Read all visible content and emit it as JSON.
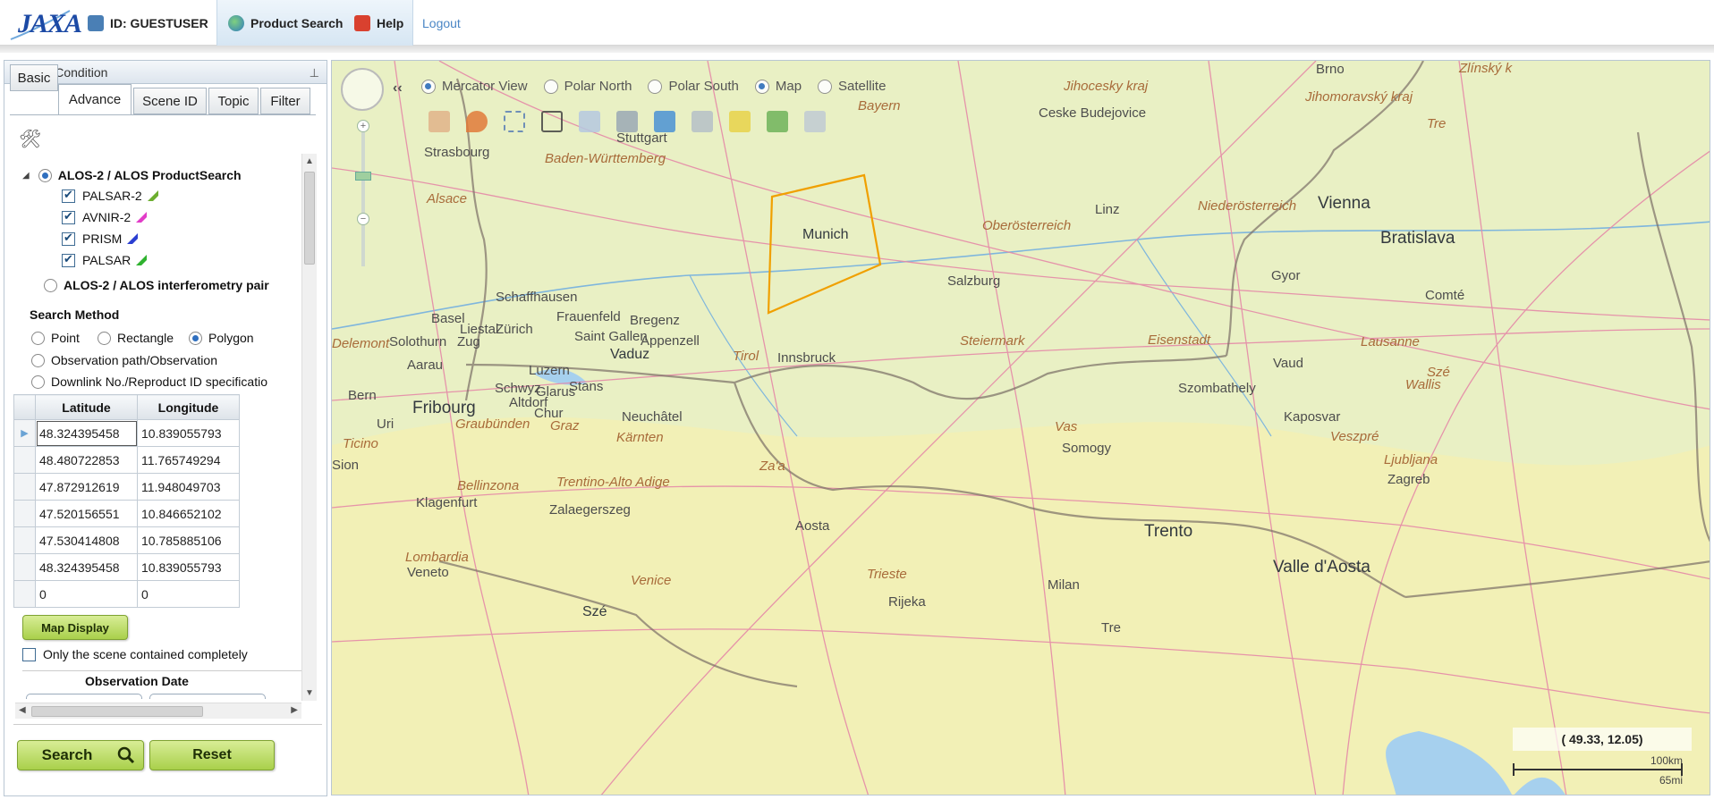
{
  "header": {
    "logo": "JAXA",
    "user_id": "ID: GUESTUSER",
    "product_search": "Product Search",
    "help": "Help",
    "logout": "Logout"
  },
  "panel": {
    "title": "Search Condition",
    "tabs": [
      "Basic",
      "Advance",
      "Scene ID",
      "Topic",
      "Filter"
    ],
    "tree": {
      "group1": "ALOS-2 / ALOS ProductSearch",
      "sensors": [
        "PALSAR-2",
        "AVNIR-2",
        "PRISM",
        "PALSAR"
      ],
      "group2": "ALOS-2 / ALOS interferometry pair"
    },
    "search_method": {
      "label": "Search Method",
      "options": [
        "Point",
        "Rectangle",
        "Polygon"
      ],
      "selected": "Polygon",
      "observation_path": "Observation path/Observation",
      "downlink": "Downlink No./Reproduct ID specificatio"
    },
    "coords_table": {
      "headers": [
        "Latitude",
        "Longitude"
      ],
      "rows": [
        [
          "48.324395458",
          "10.839055793"
        ],
        [
          "48.480722853",
          "11.765749294"
        ],
        [
          "47.872912619",
          "11.948049703"
        ],
        [
          "47.520156551",
          "10.846652102"
        ],
        [
          "47.530414808",
          "10.785885106"
        ],
        [
          "48.324395458",
          "10.839055793"
        ],
        [
          "0",
          "0"
        ]
      ]
    },
    "map_display": "Map Display",
    "only_scene": "Only the scene contained completely",
    "observation_date": "Observation Date",
    "search": "Search",
    "reset": "Reset"
  },
  "map": {
    "views": [
      "Mercator View",
      "Polar North",
      "Polar South"
    ],
    "layers": [
      "Map",
      "Satellite"
    ],
    "coord": "( 49.33, 12.05)",
    "scale_km": "100km",
    "scale_mi": "65mi",
    "places": [
      "Stuttgart",
      "Strasbourg",
      "Baden-Württemberg",
      "Bayern",
      "Jihocesky kraj",
      "Ceske Budejovice",
      "Jihomoravský kraj",
      "Brno",
      "Zlínský k",
      "Alsace",
      "Munich",
      "Linz",
      "Oberösterreich",
      "Niederösterreich",
      "Vienna",
      "Bratislava",
      "Schaffhausen",
      "Basel",
      "Liestal",
      "Zürich",
      "Frauenfeld",
      "Bregenz",
      "Saint Gallen",
      "Appenzell",
      "Vaduz",
      "Tirol",
      "Innsbruck",
      "Salzburg",
      "Steiermark",
      "Eisenstadt",
      "Gyor",
      "Comté",
      "Delemont",
      "Solothurn",
      "Aarau",
      "Zug",
      "Luzern",
      "Schwyz",
      "Glarus",
      "Stans",
      "Altdorf",
      "Chur",
      "Neuchâtel",
      "Bern",
      "Fribourg",
      "Uri",
      "Graubünden",
      "Graz",
      "Kärnten",
      "Szombathely",
      "Vas",
      "Vaud",
      "Lausanne",
      "Wallis",
      "Ticino",
      "Sion",
      "Bellinzona",
      "Trentino-Alto Adige",
      "Klagenfurt",
      "Zalaegerszeg",
      "Za'a",
      "Somogy",
      "Kaposvar",
      "Veszpré",
      "Ljubljana",
      "Zagreb",
      "Trento",
      "Valle d'Aosta",
      "Aosta",
      "Lombardia",
      "Veneto",
      "Venice",
      "Trieste",
      "Rijeka",
      "Milan",
      "Tre",
      "Szé"
    ]
  },
  "colors": {
    "accent": "#2f6fbf",
    "polygon": "#f0a000",
    "button_green": "#a9d04b",
    "map_bg": "#e9f0c4"
  }
}
